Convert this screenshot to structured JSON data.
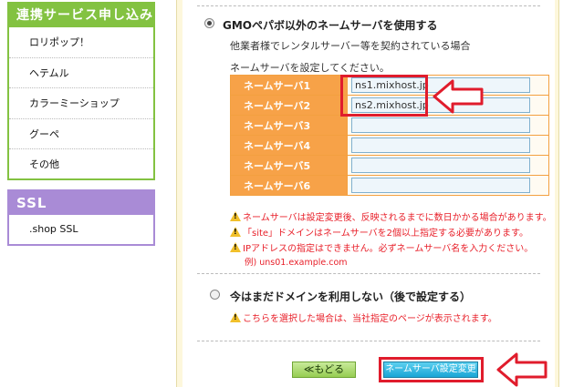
{
  "sidebar": {
    "partners_title": "連携サービス申し込み",
    "partners": [
      "ロリポップ！",
      "ヘテムル",
      "カラーミーショップ",
      "グーペ",
      "その他"
    ],
    "ssl_title": "SSL",
    "ssl_items": [
      ".shop SSL"
    ]
  },
  "option_other": {
    "label": "GMOペパボ以外のネームサーバを使用する",
    "description": "他業者様でレンタルサーバー等を契約されている場合",
    "prompt": "ネームサーバを設定してください。"
  },
  "nameservers": [
    {
      "label": "ネームサーバ1",
      "value": "ns1.mixhost.jp"
    },
    {
      "label": "ネームサーバ2",
      "value": "ns2.mixhost.jp"
    },
    {
      "label": "ネームサーバ3",
      "value": ""
    },
    {
      "label": "ネームサーバ4",
      "value": ""
    },
    {
      "label": "ネームサーバ5",
      "value": ""
    },
    {
      "label": "ネームサーバ6",
      "value": ""
    }
  ],
  "warnings": [
    "ネームサーバは設定変更後、反映されるまでに数日かかる場合があります。",
    "「site」ドメインはネームサーバを2個以上指定する必要があります。",
    "IPアドレスの指定はできません。必ずネームサーバ名を入力ください。"
  ],
  "example": "例) uns01.example.com",
  "option_later": {
    "label": "今はまだドメインを利用しない（後で設定する）",
    "warning": "こちらを選択した場合は、当社指定のページが表示されます。"
  },
  "buttons": {
    "back": "≪もどる",
    "submit": "ネームサーバ設定変更"
  },
  "colors": {
    "sidebar_green": "#83c241",
    "ssl_purple": "#a98bd6",
    "table_orange": "#f7a248",
    "highlight_red": "#e01c2c",
    "warning_red": "#e8202a"
  }
}
